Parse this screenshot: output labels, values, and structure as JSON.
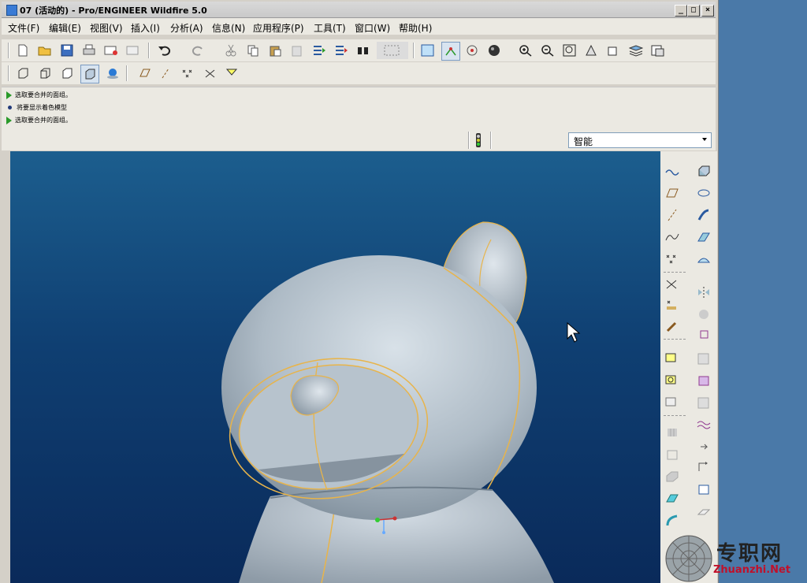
{
  "window": {
    "title": "07 (活动的) - Pro/ENGINEER Wildfire 5.0",
    "min_label": "_",
    "max_label": "□",
    "close_label": "×"
  },
  "menu": [
    "文件(F)",
    "编辑(E)",
    "视图(V)",
    "插入(I)",
    "分析(A)",
    "信息(N)",
    "应用程序(P)",
    "工具(T)",
    "窗口(W)",
    "帮助(H)"
  ],
  "messages": [
    {
      "icon": "green-arrow-icon",
      "text": "选取要合并的面组。"
    },
    {
      "icon": "dot-icon",
      "text": "将要显示着色模型"
    },
    {
      "icon": "green-arrow-icon",
      "text": "选取要合并的面组。"
    }
  ],
  "filter": {
    "value": "智能"
  },
  "watermark": {
    "cn": "专职网",
    "en": "Zhuanzhi.Net"
  },
  "colors": {
    "viewport_top": "#1c5e8e",
    "viewport_bottom": "#0a2a5a",
    "model": "#b9c5cf",
    "edge": "#e8b44a"
  }
}
